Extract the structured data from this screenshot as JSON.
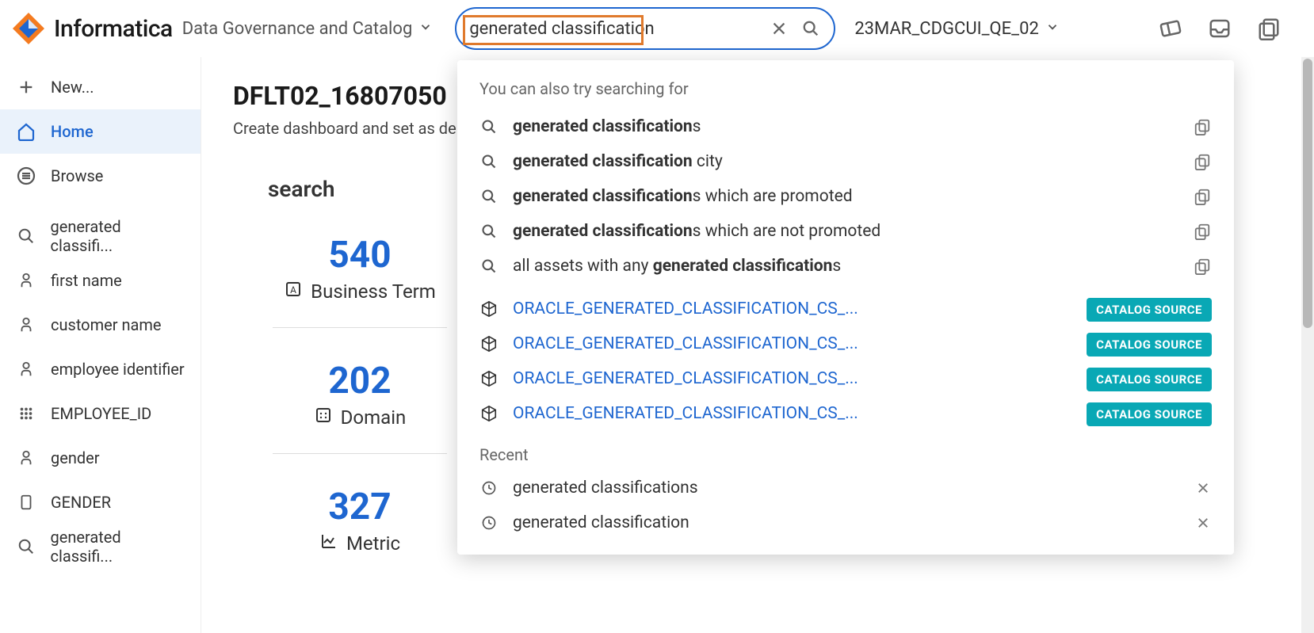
{
  "header": {
    "brand": "Informatica",
    "app_name": "Data Governance and Catalog",
    "search_value": "generated classification",
    "org_name": "23MAR_CDGCUI_QE_02"
  },
  "sidebar": {
    "new_label": "New...",
    "home_label": "Home",
    "browse_label": "Browse",
    "items": [
      {
        "label": "generated classifi...",
        "icon": "search"
      },
      {
        "label": "first name",
        "icon": "term"
      },
      {
        "label": "customer name",
        "icon": "term"
      },
      {
        "label": "employee identifier",
        "icon": "term"
      },
      {
        "label": "EMPLOYEE_ID",
        "icon": "grid"
      },
      {
        "label": "gender",
        "icon": "term"
      },
      {
        "label": "GENDER",
        "icon": "column"
      },
      {
        "label": "generated classifi...",
        "icon": "search"
      }
    ]
  },
  "dashboard": {
    "title": "DFLT02_16807050",
    "subtitle": "Create dashboard and set as de",
    "panel_title": "search",
    "stats": [
      {
        "value": "540",
        "label": "Business Term"
      },
      {
        "value": "202",
        "label": "Domain"
      },
      {
        "value": "327",
        "label": "Metric"
      }
    ]
  },
  "dropdown": {
    "hint": "You can also try searching for",
    "suggestions": [
      {
        "bold": "generated classification",
        "rest": "s"
      },
      {
        "bold": "generated classification",
        "rest": " city"
      },
      {
        "bold": "generated classification",
        "rest": "s which are promoted"
      },
      {
        "bold": "generated classification",
        "rest": "s which are not promoted"
      },
      {
        "pre": "all assets with any ",
        "bold": "generated classification",
        "rest": "s"
      }
    ],
    "assets": [
      {
        "name": "ORACLE_GENERATED_CLASSIFICATION_CS_...",
        "badge": "CATALOG SOURCE"
      },
      {
        "name": "ORACLE_GENERATED_CLASSIFICATION_CS_...",
        "badge": "CATALOG SOURCE"
      },
      {
        "name": "ORACLE_GENERATED_CLASSIFICATION_CS_...",
        "badge": "CATALOG SOURCE"
      },
      {
        "name": "ORACLE_GENERATED_CLASSIFICATION_CS_...",
        "badge": "CATALOG SOURCE"
      }
    ],
    "recent_label": "Recent",
    "recent": [
      {
        "text": "generated classifications"
      },
      {
        "text": "generated classification"
      }
    ]
  }
}
